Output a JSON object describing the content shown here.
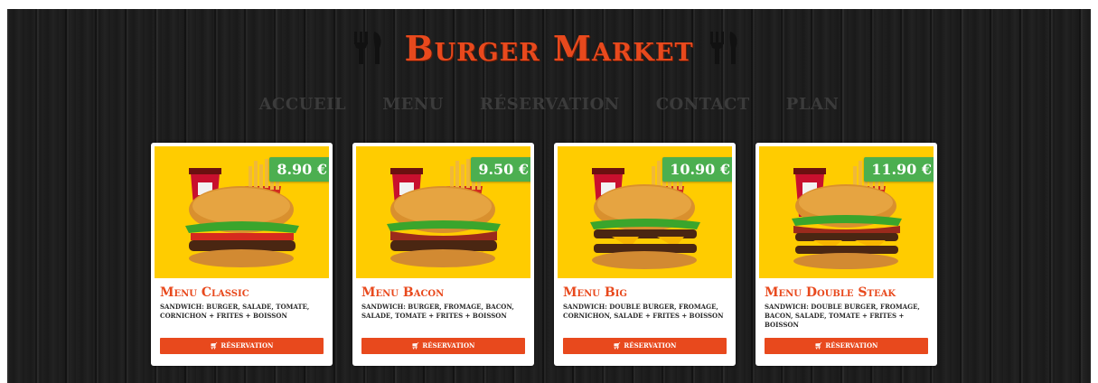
{
  "header": {
    "title": "Burger Market",
    "left_icon": "fork-knife-icon",
    "right_icon": "fork-knife-icon"
  },
  "nav": {
    "items": [
      {
        "label": "Accueil"
      },
      {
        "label": "Menu"
      },
      {
        "label": "Réservation"
      },
      {
        "label": "Contact"
      },
      {
        "label": "Plan"
      }
    ]
  },
  "menus": [
    {
      "price": "8.90 €",
      "title": "Menu Classic",
      "desc": "Sandwich: Burger, Salade, Tomate, Cornichon + Frites + Boisson",
      "button": "Réservation",
      "image": "menu-classic-photo"
    },
    {
      "price": "9.50 €",
      "title": "Menu Bacon",
      "desc": "Sandwich: Burger, Fromage, Bacon, Salade, Tomate + Frites + Boisson",
      "button": "Réservation",
      "image": "menu-bacon-photo"
    },
    {
      "price": "10.90 €",
      "title": "Menu Big",
      "desc": "Sandwich: Double Burger, Fromage, Cornichon, Salade + Frites + Boisson",
      "button": "Réservation",
      "image": "menu-big-photo"
    },
    {
      "price": "11.90 €",
      "title": "Menu Double Steak",
      "desc": "Sandwich: Double Burger, Fromage, Bacon, Salade, Tomate + Frites + Boisson",
      "button": "Réservation",
      "image": "menu-double-steak-photo"
    }
  ],
  "colors": {
    "accent": "#e8491d",
    "price_badge": "#4caf50",
    "card_image_bg": "#ffcc00",
    "background": "#1b1b1b",
    "nav_text": "#3b3b3b"
  }
}
